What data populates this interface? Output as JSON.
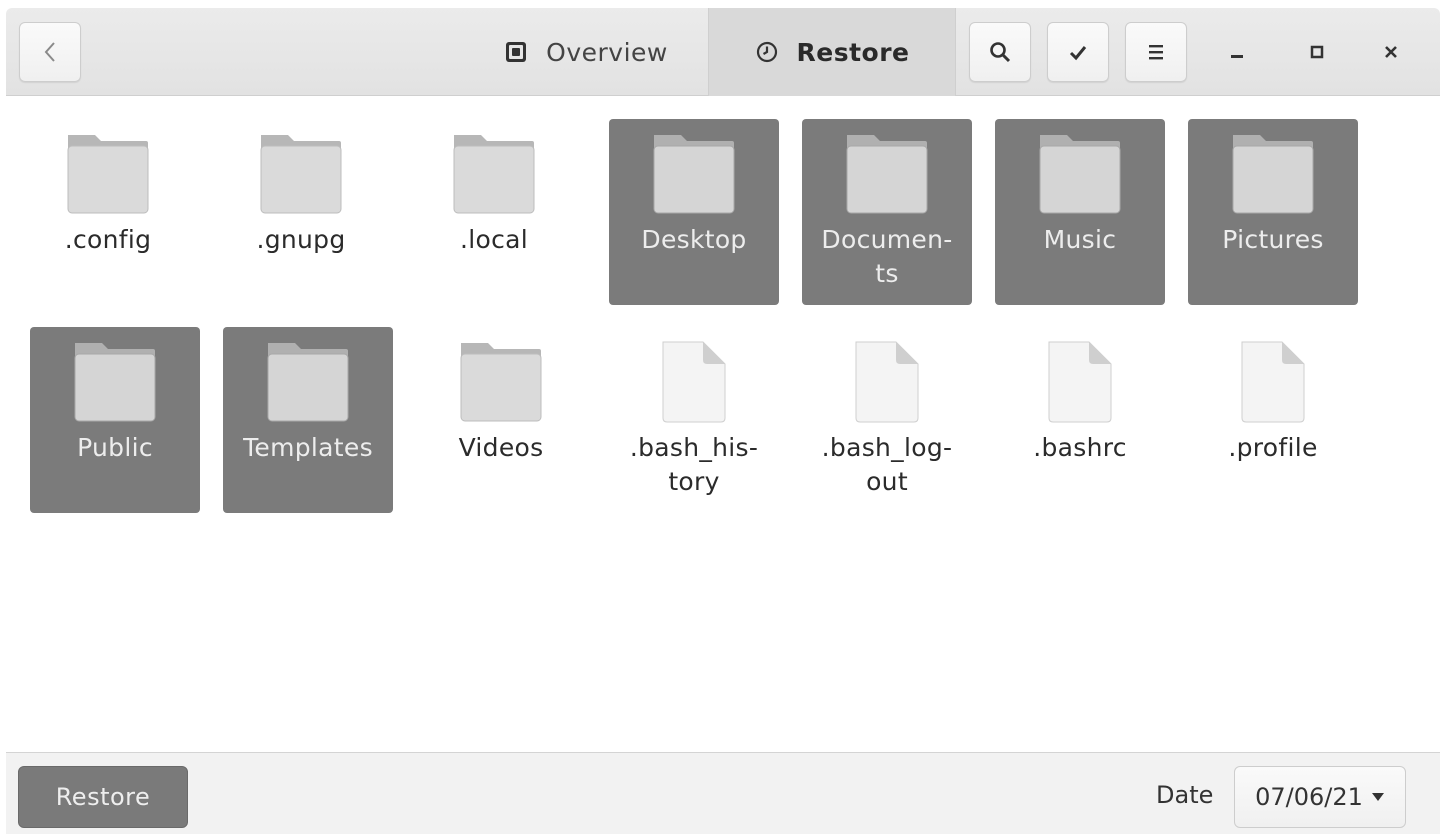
{
  "header": {
    "tabs": [
      {
        "label": "Overview",
        "icon": "overview-icon",
        "active": false
      },
      {
        "label": "Restore",
        "icon": "clock-icon",
        "active": true
      }
    ],
    "buttons": [
      "back-icon",
      "search-icon",
      "checkmark-icon",
      "hamburger-menu-icon"
    ],
    "window_controls": [
      "minimize-icon",
      "maximize-icon",
      "close-icon"
    ]
  },
  "files": [
    {
      "name": ".config",
      "type": "folder",
      "selected": false
    },
    {
      "name": ".gnupg",
      "type": "folder",
      "selected": false
    },
    {
      "name": ".local",
      "type": "folder",
      "selected": false
    },
    {
      "name": "Desktop",
      "type": "folder",
      "selected": true
    },
    {
      "name": "Documen-ts",
      "display_lines": [
        "Documen-",
        "ts"
      ],
      "type": "folder",
      "selected": true
    },
    {
      "name": "Music",
      "type": "folder",
      "selected": true
    },
    {
      "name": "Pictures",
      "type": "folder",
      "selected": true
    },
    {
      "name": "Public",
      "type": "folder",
      "selected": true
    },
    {
      "name": "Templates",
      "type": "folder",
      "selected": true
    },
    {
      "name": "Videos",
      "type": "folder",
      "selected": false
    },
    {
      "name": ".bash_his-tory",
      "display_lines": [
        ".bash_his-",
        "tory"
      ],
      "type": "file",
      "selected": false
    },
    {
      "name": ".bash_log-out",
      "display_lines": [
        ".bash_log-",
        "out"
      ],
      "type": "file",
      "selected": false
    },
    {
      "name": ".bashrc",
      "type": "file",
      "selected": false
    },
    {
      "name": ".profile",
      "type": "file",
      "selected": false
    }
  ],
  "footer": {
    "restore_label": "Restore",
    "date_label": "Date",
    "date_value": "07/06/21"
  },
  "colors": {
    "selected_tile": "#7b7b7b",
    "header_bg": "#e6e6e6",
    "active_tab_bg": "#d9d9d9",
    "restore_button_bg": "#7a7a7a"
  }
}
